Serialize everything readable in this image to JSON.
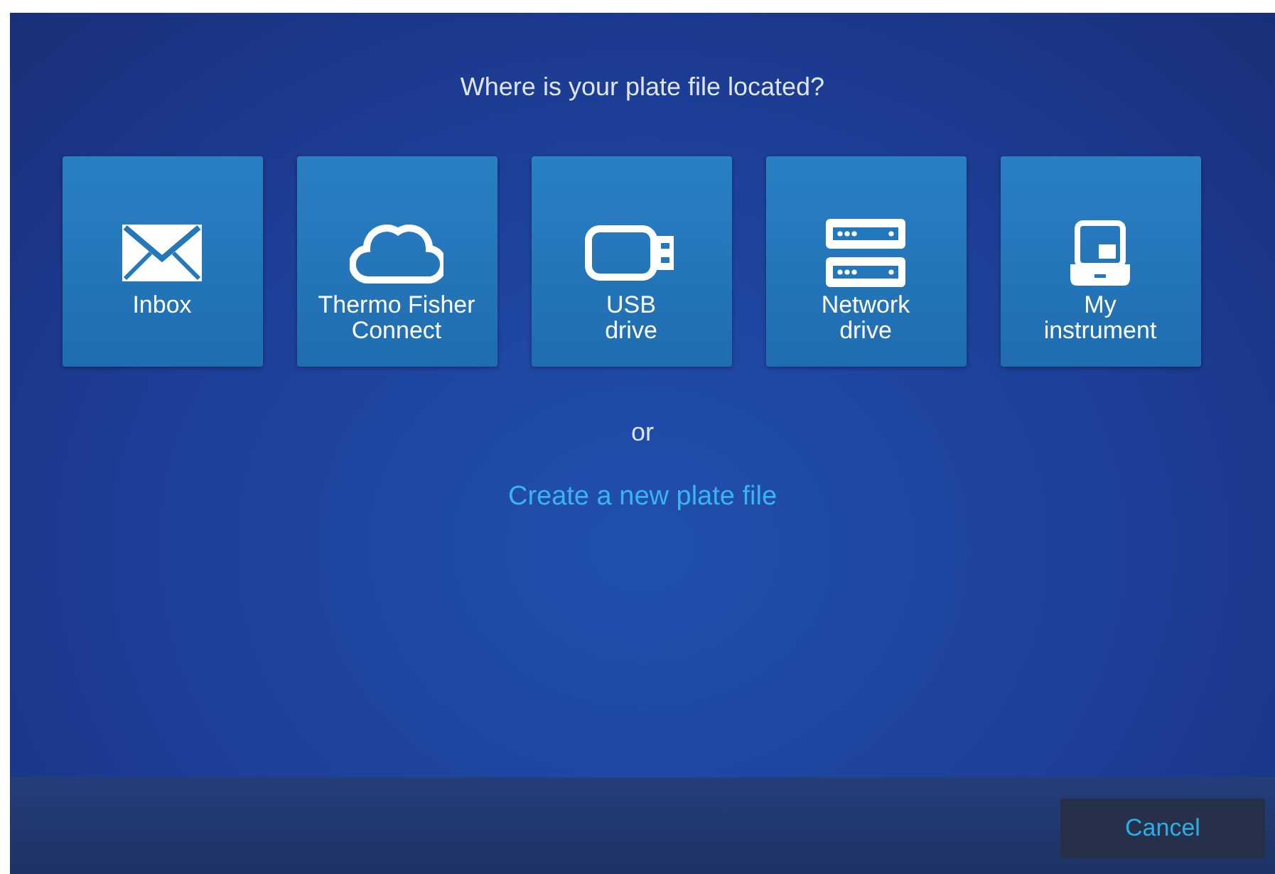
{
  "prompt": "Where is your plate file located?",
  "locations": [
    {
      "kind": "inbox",
      "label": [
        "Inbox"
      ]
    },
    {
      "kind": "cloud",
      "label": [
        "Thermo Fisher",
        "Connect"
      ]
    },
    {
      "kind": "usb",
      "label": [
        "USB",
        "drive"
      ]
    },
    {
      "kind": "network",
      "label": [
        "Network",
        "drive"
      ]
    },
    {
      "kind": "instrument",
      "label": [
        "My",
        "instrument"
      ]
    }
  ],
  "separator": "or",
  "create_link": "Create a new plate file",
  "footer": {
    "cancel": "Cancel"
  }
}
